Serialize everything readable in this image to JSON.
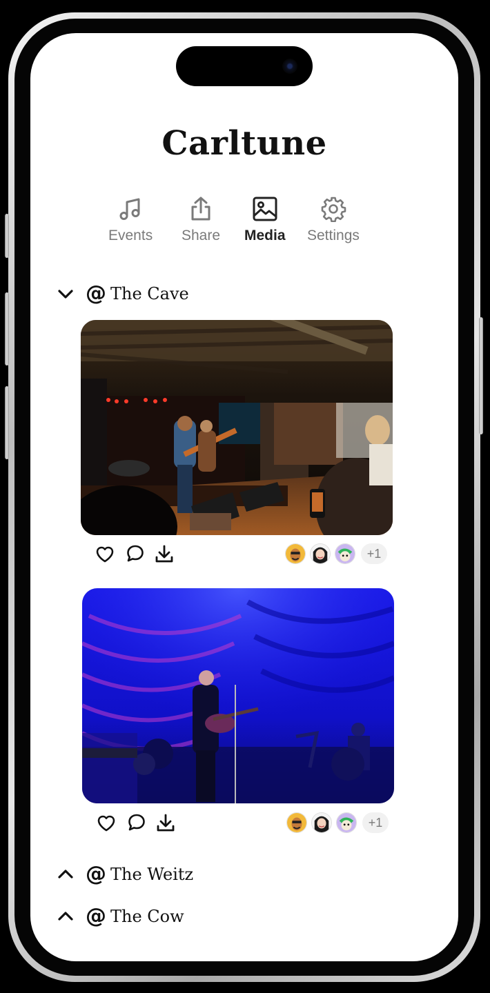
{
  "app": {
    "title": "Carltune"
  },
  "tabs": [
    {
      "label": "Events",
      "icon": "music-note-icon",
      "active": false
    },
    {
      "label": "Share",
      "icon": "share-icon",
      "active": false
    },
    {
      "label": "Media",
      "icon": "image-icon",
      "active": true
    },
    {
      "label": "Settings",
      "icon": "gear-icon",
      "active": false
    }
  ],
  "sections": [
    {
      "at": "@",
      "venue": "The Cave",
      "expanded": true,
      "photos": [
        {
          "description_icon": "concert-photo-small-stage",
          "viewers_more": "+1"
        },
        {
          "description_icon": "concert-photo-blue-stage",
          "viewers_more": "+1"
        }
      ]
    },
    {
      "at": "@",
      "venue": "The Weitz",
      "expanded": false
    },
    {
      "at": "@",
      "venue": "The Cow",
      "expanded": false
    }
  ],
  "colors": {
    "accent_text": "#111111",
    "muted_text": "#7a7a7a",
    "stage_blue": "#1a1ae0"
  }
}
